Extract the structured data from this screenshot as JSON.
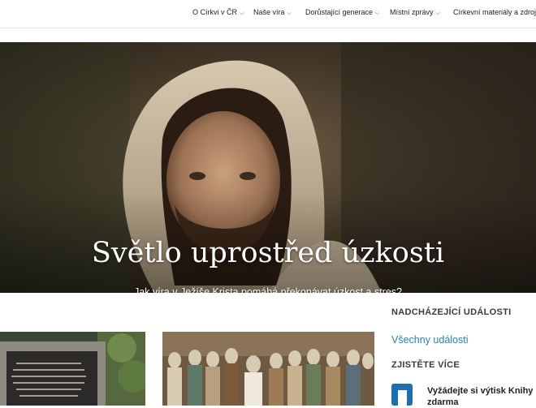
{
  "nav": {
    "items": [
      {
        "label": "O Církvi v ČR"
      },
      {
        "label": "Naše víra"
      },
      {
        "label": "Dorůstající generace"
      },
      {
        "label": "Místní zprávy"
      },
      {
        "label": "Církevní materiály a zdroje"
      }
    ]
  },
  "hero": {
    "title": "Světlo uprostřed úzkosti",
    "subtitle": "Jak víra v Ježíše Krista pomáhá překonávat úzkost a stres?"
  },
  "sidebar": {
    "events_heading": "NADCHÁZEJÍCÍ UDÁLOSTI",
    "events_link": "Všechny události",
    "more_heading": "ZJISTĚTE VÍCE",
    "promo_line1": "Vyžádejte si výtisk Knihy M",
    "promo_line2": "zdarma"
  },
  "colors": {
    "link": "#2b7fb8",
    "promo_icon": "#1d6fb0"
  }
}
